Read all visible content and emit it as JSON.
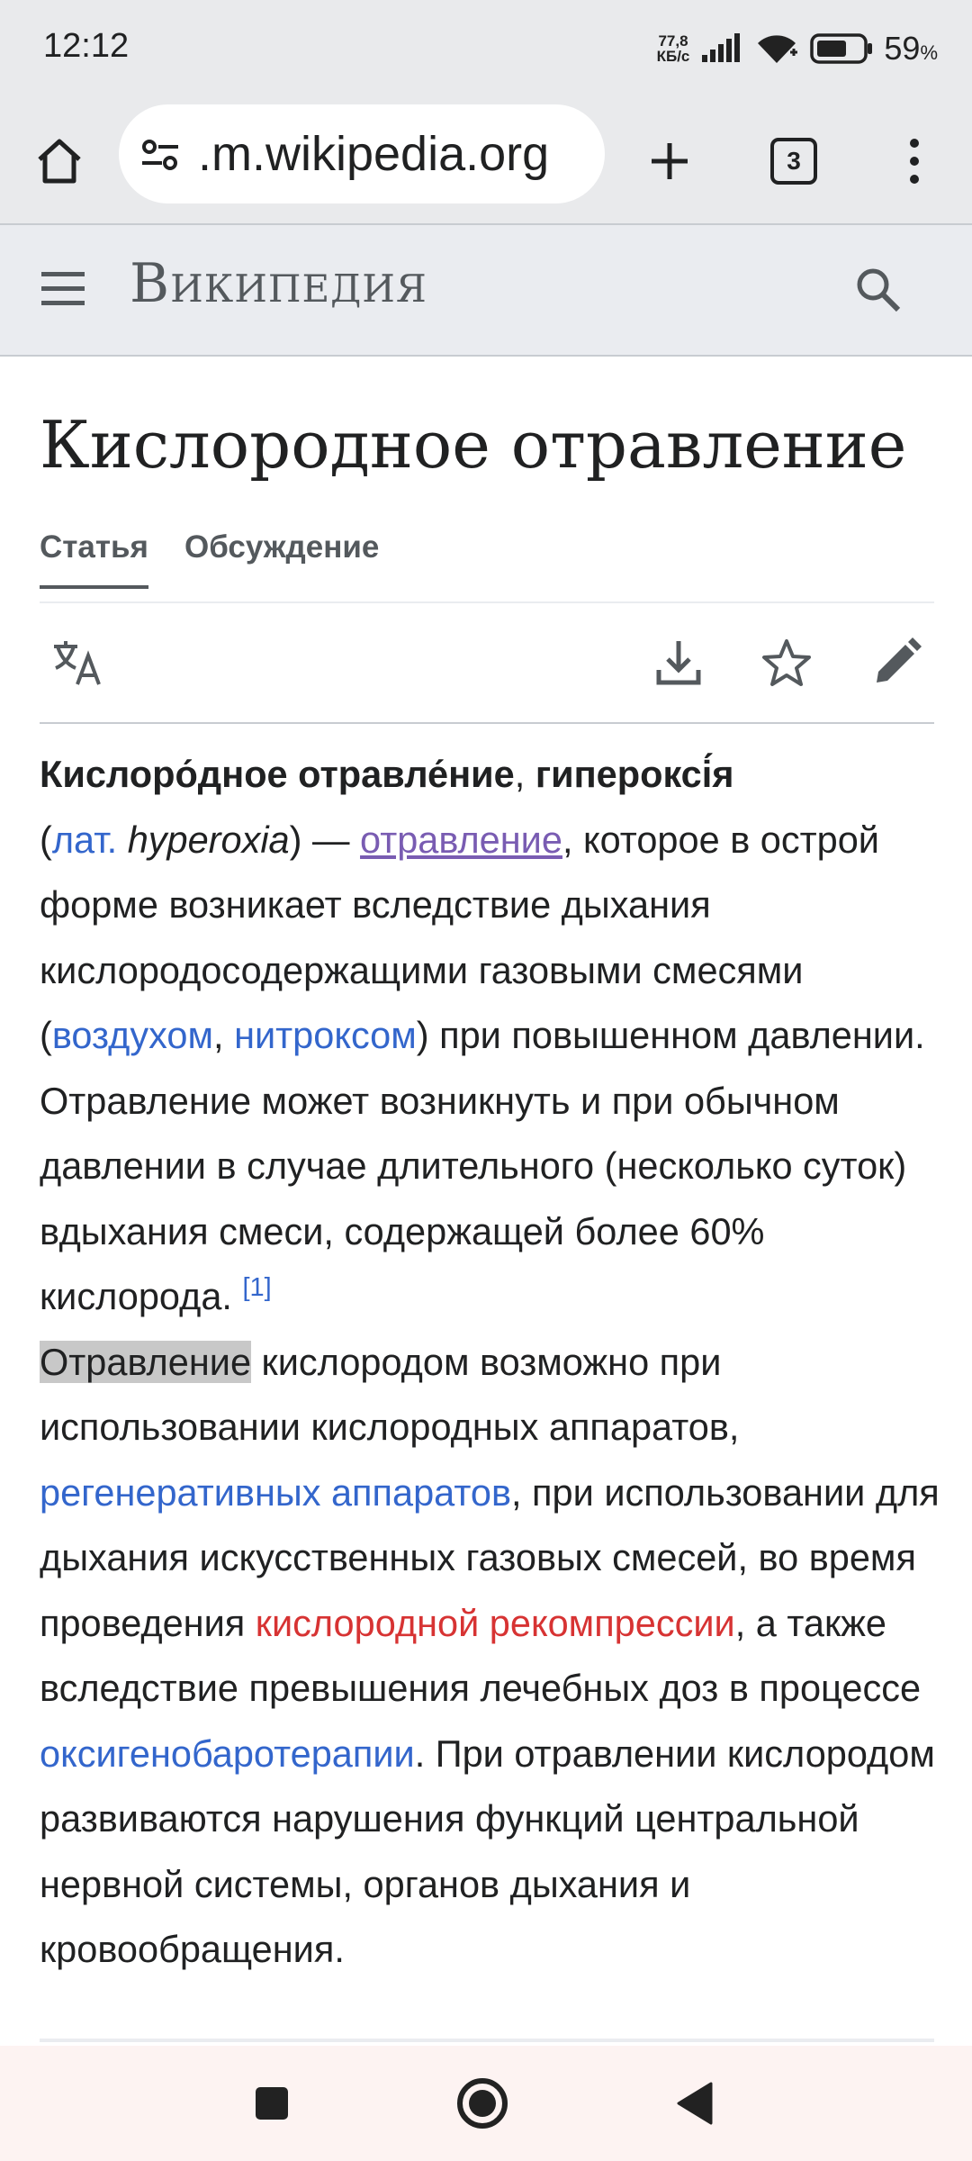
{
  "status_bar": {
    "time": "12:12",
    "net_speed_value": "77,8",
    "net_speed_unit": "КБ/с",
    "battery_percent": "59",
    "battery_suffix": "%"
  },
  "browser": {
    "url": ".m.wikipedia.org",
    "tab_count": "3",
    "icons": [
      "home-icon",
      "site-settings-icon",
      "new-tab-icon",
      "tab-switcher-icon",
      "overflow-menu-icon"
    ]
  },
  "wiki_header": {
    "logo_text": "Википедия",
    "icons": [
      "menu-icon",
      "search-icon"
    ]
  },
  "page": {
    "title": "Кислородное отравление",
    "tabs": [
      {
        "label": "Статья",
        "active": true
      },
      {
        "label": "Обсуждение",
        "active": false
      }
    ],
    "action_icons": [
      "language-icon",
      "download-icon",
      "watch-star-icon",
      "edit-pencil-icon"
    ]
  },
  "article": {
    "term1": "Кислоро́дное отравле́ние",
    "comma": ", ",
    "term2": "гипероксі́я",
    "lat_open": "(",
    "lat_link": "лат.",
    "lat_word": "hyperoxia",
    "lat_close": ") — ",
    "link_poisoning": "отравление",
    "text1": ", которое в острой форме возникает вследствие дыхания кислородосодержащими газовыми смесями (",
    "link_air": "воздухом",
    "text_comma": ", ",
    "link_nitrox": "нитроксом",
    "text2": ") при повышенном давлении. Отравление может возникнуть и при обычном давлении в случае длительного (несколько суток) вдыхания смеси, содержащей более 60% кислорода. ",
    "ref1": "[1]",
    "highlight_word": "Отравление",
    "text3": " кислородом возможно при использовании кислородных аппаратов, ",
    "link_regen": "регенеративных аппаратов",
    "text4": ", при использовании для дыхания искусственных газовых смесей, во время проведения ",
    "link_recompression": "кислородной рекомпрессии",
    "text5": ", а также вследствие превышения лечебных доз в процессе ",
    "link_hbo": "оксигенобаротерапии",
    "text6": ". При отравлении кислородом развиваются нарушения функций центральной нервной системы, органов дыхания и кровообращения."
  },
  "colors": {
    "link": "#3366cc",
    "visited_link": "#795cb2",
    "red_link": "#d73333",
    "chrome_bg": "#e9eaec",
    "nav_bg": "#fdf3f2"
  },
  "nav_bar": {
    "icons": [
      "recent-apps-icon",
      "home-button-icon",
      "back-icon"
    ]
  }
}
